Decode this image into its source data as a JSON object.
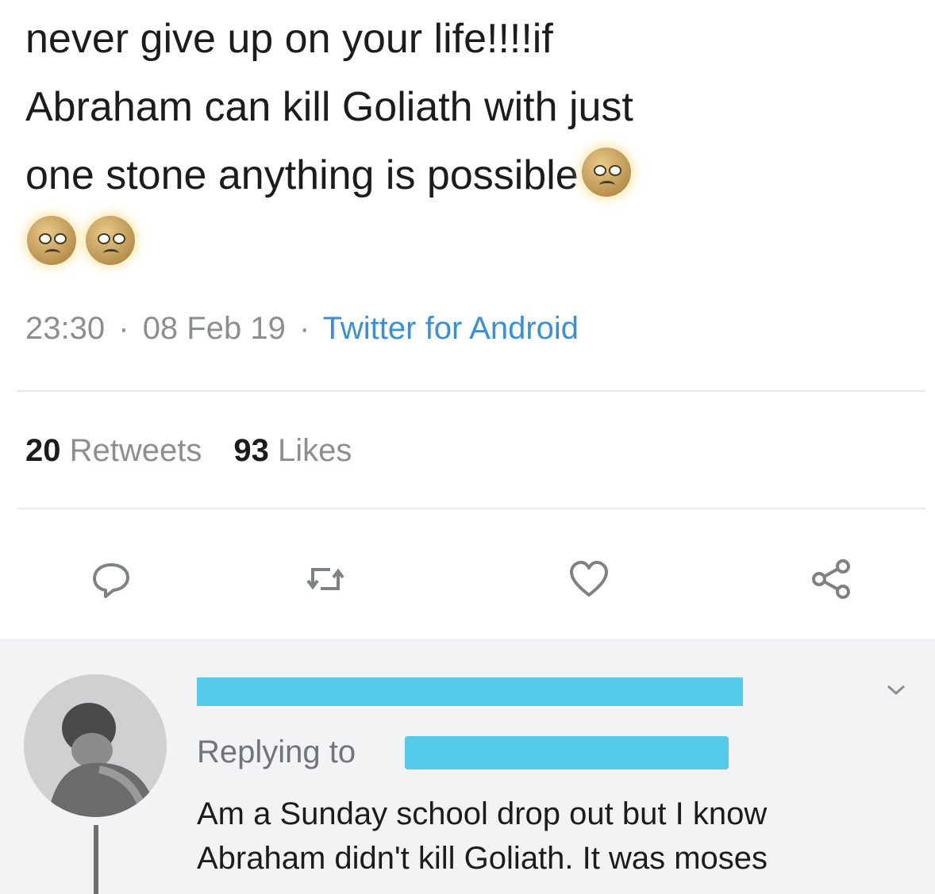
{
  "tweet": {
    "line1": "never give up on your life!!!!if",
    "line2": "Abraham can kill Goliath with just",
    "line3": "one stone anything is possible",
    "emoji_name": "face-with-rolling-eyes",
    "timestamp": "23:30",
    "date": "08 Feb 19",
    "separator": "·",
    "source": "Twitter for Android",
    "retweets_count": "20",
    "retweets_label": "Retweets",
    "likes_count": "93",
    "likes_label": "Likes"
  },
  "actions": {
    "reply_icon": "speech-bubble-icon",
    "retweet_icon": "retweet-icon",
    "like_icon": "heart-icon",
    "share_icon": "share-icon"
  },
  "reply": {
    "replying_to_label": "Replying to",
    "text_line1": "Am a Sunday school drop out but I know",
    "text_line2": "Abraham didn't kill Goliath. It was moses"
  },
  "colors": {
    "link_blue": "#3a8fd8",
    "redaction_blue": "#55c9e8",
    "muted_gray": "#8a8f94"
  }
}
